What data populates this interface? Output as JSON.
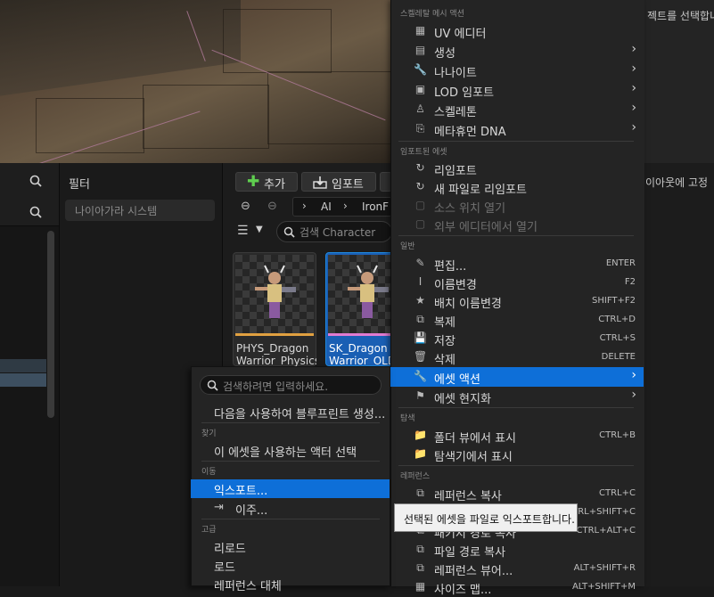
{
  "right_panel": {
    "hint": "젝트를 선택합니",
    "hint2": "이아웃에 고정"
  },
  "filters": {
    "title": "필터",
    "search_placeholder": "나이아가라 시스템"
  },
  "content_browser": {
    "add_label": "추가",
    "import_label": "임포트",
    "path": [
      "AI",
      "IronF"
    ],
    "search_placeholder": "검색 Character",
    "assets": [
      {
        "line1": "PHYS_Dragon",
        "line2": "Warrior_Physics",
        "bar_color": "#e0a040"
      },
      {
        "line1": "SK_Dragon",
        "line2": "Warrior_OLD",
        "bar_color": "#e07bd0"
      }
    ]
  },
  "context_menu": {
    "sections": {
      "skeletal": "스켈레탈 메시 액션",
      "imported": "임포트된 에셋",
      "general": "일반",
      "explore": "탐색",
      "references": "레퍼런스"
    },
    "items": [
      {
        "label": "UV 에디터",
        "icon": "uv-grid-icon",
        "glyph": "▦",
        "shortcut": "",
        "submenu": false
      },
      {
        "label": "생성",
        "icon": "create-icon",
        "glyph": "▤",
        "shortcut": "",
        "submenu": true
      },
      {
        "label": "나나이트",
        "icon": "wrench-icon",
        "glyph": "🔧",
        "shortcut": "",
        "submenu": true
      },
      {
        "label": "LOD 임포트",
        "icon": "lod-icon",
        "glyph": "▣",
        "shortcut": "",
        "submenu": true
      },
      {
        "label": "스켈레톤",
        "icon": "skeleton-icon",
        "glyph": "♙",
        "shortcut": "",
        "submenu": true
      },
      {
        "label": "메타휴먼 DNA",
        "icon": "dna-import-icon",
        "glyph": "⎘",
        "shortcut": "",
        "submenu": true
      },
      {
        "label": "리임포트",
        "icon": "reimport-icon",
        "glyph": "↻",
        "shortcut": "",
        "submenu": false
      },
      {
        "label": "새 파일로 리임포트",
        "icon": "reimport-new-icon",
        "glyph": "↻",
        "shortcut": "",
        "submenu": false
      },
      {
        "label": "소스 위치 열기",
        "icon": "open-source-icon",
        "glyph": "▢",
        "shortcut": "",
        "submenu": false,
        "disabled": true
      },
      {
        "label": "외부 에디터에서 열기",
        "icon": "external-editor-icon",
        "glyph": "▢",
        "shortcut": "",
        "submenu": false,
        "disabled": true
      },
      {
        "label": "편집...",
        "icon": "pencil-icon",
        "glyph": "✎",
        "shortcut": "ENTER",
        "submenu": false
      },
      {
        "label": "이름변경",
        "icon": "rename-icon",
        "glyph": "Ⅰ",
        "shortcut": "F2",
        "submenu": false
      },
      {
        "label": "배치 이름변경",
        "icon": "batch-rename-icon",
        "glyph": "★",
        "shortcut": "SHIFT+F2",
        "submenu": false
      },
      {
        "label": "복제",
        "icon": "duplicate-icon",
        "glyph": "⧉",
        "shortcut": "CTRL+D",
        "submenu": false
      },
      {
        "label": "저장",
        "icon": "save-icon",
        "glyph": "💾",
        "shortcut": "CTRL+S",
        "submenu": false
      },
      {
        "label": "삭제",
        "icon": "trash-icon",
        "glyph": "🗑",
        "shortcut": "DELETE",
        "submenu": false
      },
      {
        "label": "에셋 액션",
        "icon": "asset-actions-icon",
        "glyph": "🔧",
        "shortcut": "",
        "submenu": true,
        "highlighted": true
      },
      {
        "label": "에셋 현지화",
        "icon": "flag-icon",
        "glyph": "⚑",
        "shortcut": "",
        "submenu": true
      },
      {
        "label": "폴더 뷰에서 표시",
        "icon": "folder-search-icon",
        "glyph": "📁",
        "shortcut": "CTRL+B",
        "submenu": false
      },
      {
        "label": "탐색기에서 표시",
        "icon": "explorer-icon",
        "glyph": "📁",
        "shortcut": "",
        "submenu": false
      },
      {
        "label": "레퍼런스 복사",
        "icon": "copy-reference-icon",
        "glyph": "⧉",
        "shortcut": "CTRL+C",
        "submenu": false
      },
      {
        "label": "",
        "icon": "copy-path-icon",
        "glyph": "⧉",
        "shortcut": "CTRL+SHIFT+C",
        "submenu": false
      },
      {
        "label": "패키지 경로 복사",
        "icon": "copy-package-path-icon",
        "glyph": "⧉",
        "shortcut": "CTRL+ALT+C",
        "submenu": false
      },
      {
        "label": "파일 경로 복사",
        "icon": "copy-file-path-icon",
        "glyph": "⧉",
        "shortcut": "",
        "submenu": false
      },
      {
        "label": "레퍼런스 뷰어...",
        "icon": "reference-viewer-icon",
        "glyph": "⧉",
        "shortcut": "ALT+SHIFT+R",
        "submenu": false
      },
      {
        "label": "사이즈 맵...",
        "icon": "size-map-icon",
        "glyph": "▦",
        "shortcut": "ALT+SHIFT+M",
        "submenu": false
      }
    ]
  },
  "popup_menu": {
    "search_placeholder": "검색하려면 입력하세요.",
    "sections": {
      "find": "찾기",
      "move": "이동",
      "advanced": "고급"
    },
    "items": [
      {
        "label": "다음을 사용하여 블루프린트 생성..."
      },
      {
        "label": "이 에셋을 사용하는 액터 선택"
      },
      {
        "label": "익스포트...",
        "highlighted": true
      },
      {
        "label": "이주..."
      },
      {
        "label": "리로드"
      },
      {
        "label": "로드"
      },
      {
        "label": "레퍼런스 대체"
      }
    ]
  },
  "tooltip": {
    "text": "선택된 에셋을 파일로 익스포트합니다."
  }
}
